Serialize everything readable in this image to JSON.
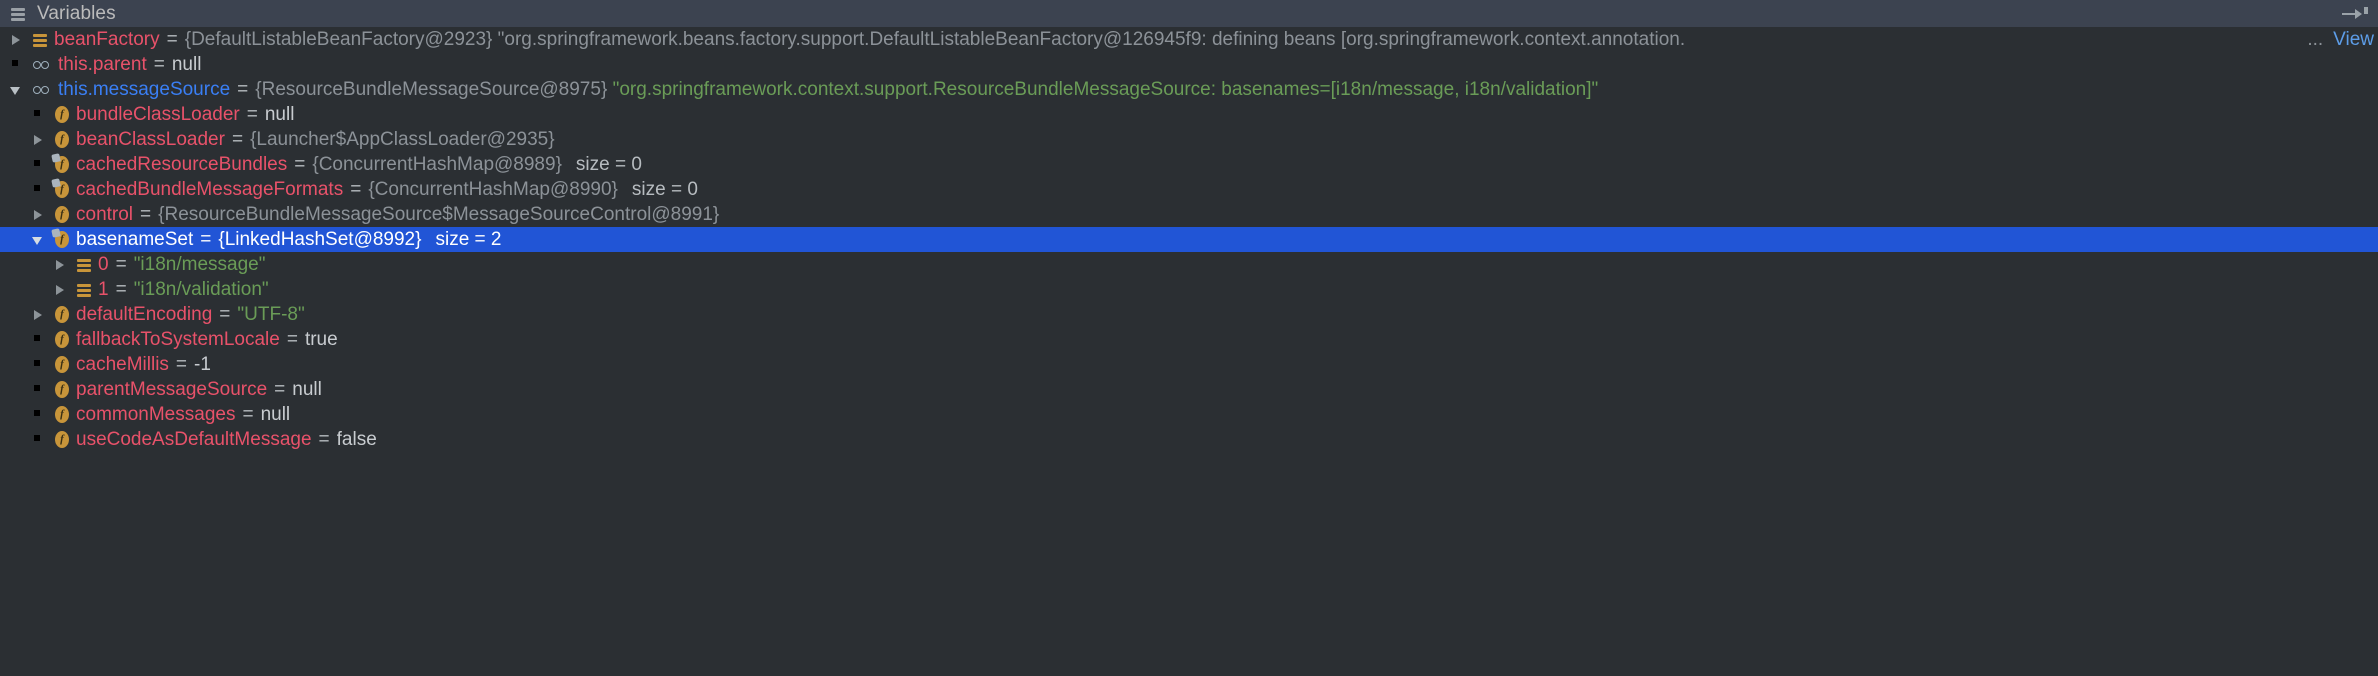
{
  "window": {
    "title": "Variables",
    "title_icon": "variables-list-icon",
    "hide_icon": "hide-tool-window-arrow-icon",
    "background": "#3c4350",
    "tree_background": "#2b2f33"
  },
  "colors": {
    "selection": "#2155d6",
    "name": "#e8526a",
    "watch_name": "#3a7ff5",
    "reference_value": "#8c9298",
    "string_value": "#6a9c57",
    "literal_value": "#c8ccd0",
    "link": "#5d9de8",
    "field_icon": "#c8953a"
  },
  "tree": {
    "rows": [
      {
        "indent": 0,
        "toggle": "collapsed",
        "icon": "array-icon",
        "name": "beanFactory",
        "eq": "=",
        "ref": "{DefaultListableBeanFactory@2923}",
        "string": "\"org.springframework.beans.factory.support.DefaultListableBeanFactory@126945f9: defining beans [org.springframework.context.annotation.",
        "truncation": "...",
        "link": "View",
        "selected": false
      },
      {
        "indent": 0,
        "toggle": "none",
        "icon": "watch-icon",
        "name": "this.parent",
        "eq": "=",
        "literal": "null",
        "selected": false
      },
      {
        "indent": 0,
        "toggle": "expanded",
        "icon": "watch-icon",
        "name": "this.messageSource",
        "name_style": "watch",
        "eq": "=",
        "ref": "{ResourceBundleMessageSource@8975}",
        "string": "\"org.springframework.context.support.ResourceBundleMessageSource: basenames=[i18n/message, i18n/validation]\"",
        "selected": false
      },
      {
        "indent": 1,
        "toggle": "none",
        "icon": "field-icon",
        "name": "bundleClassLoader",
        "eq": "=",
        "literal": "null",
        "selected": false
      },
      {
        "indent": 1,
        "toggle": "collapsed",
        "icon": "field-icon",
        "name": "beanClassLoader",
        "eq": "=",
        "ref": "{Launcher$AppClassLoader@2935}",
        "selected": false
      },
      {
        "indent": 1,
        "toggle": "none",
        "icon": "field-final-icon",
        "name": "cachedResourceBundles",
        "eq": "=",
        "ref": "{ConcurrentHashMap@8989}",
        "size": "size = 0",
        "selected": false
      },
      {
        "indent": 1,
        "toggle": "none",
        "icon": "field-final-icon",
        "name": "cachedBundleMessageFormats",
        "eq": "=",
        "ref": "{ConcurrentHashMap@8990}",
        "size": "size = 0",
        "selected": false
      },
      {
        "indent": 1,
        "toggle": "collapsed",
        "icon": "field-icon",
        "name": "control",
        "eq": "=",
        "ref": "{ResourceBundleMessageSource$MessageSourceControl@8991}",
        "selected": false
      },
      {
        "indent": 1,
        "toggle": "expanded",
        "icon": "field-final-icon",
        "name": "basenameSet",
        "eq": "=",
        "ref": "{LinkedHashSet@8992}",
        "size": "size = 2",
        "selected": true
      },
      {
        "indent": 2,
        "toggle": "collapsed",
        "icon": "array-icon",
        "name": "0",
        "eq": "=",
        "string": "\"i18n/message\"",
        "selected": false
      },
      {
        "indent": 2,
        "toggle": "collapsed",
        "icon": "array-icon",
        "name": "1",
        "eq": "=",
        "string": "\"i18n/validation\"",
        "selected": false
      },
      {
        "indent": 1,
        "toggle": "collapsed",
        "icon": "field-icon",
        "name": "defaultEncoding",
        "eq": "=",
        "string": "\"UTF-8\"",
        "selected": false
      },
      {
        "indent": 1,
        "toggle": "none",
        "icon": "field-icon",
        "name": "fallbackToSystemLocale",
        "eq": "=",
        "literal": "true",
        "selected": false
      },
      {
        "indent": 1,
        "toggle": "none",
        "icon": "field-icon",
        "name": "cacheMillis",
        "eq": "=",
        "literal": "-1",
        "selected": false
      },
      {
        "indent": 1,
        "toggle": "none",
        "icon": "field-icon",
        "name": "parentMessageSource",
        "eq": "=",
        "literal": "null",
        "selected": false
      },
      {
        "indent": 1,
        "toggle": "none",
        "icon": "field-icon",
        "name": "commonMessages",
        "eq": "=",
        "literal": "null",
        "selected": false
      },
      {
        "indent": 1,
        "toggle": "none",
        "icon": "field-icon",
        "name": "useCodeAsDefaultMessage",
        "eq": "=",
        "literal": "false",
        "selected": false
      }
    ]
  }
}
